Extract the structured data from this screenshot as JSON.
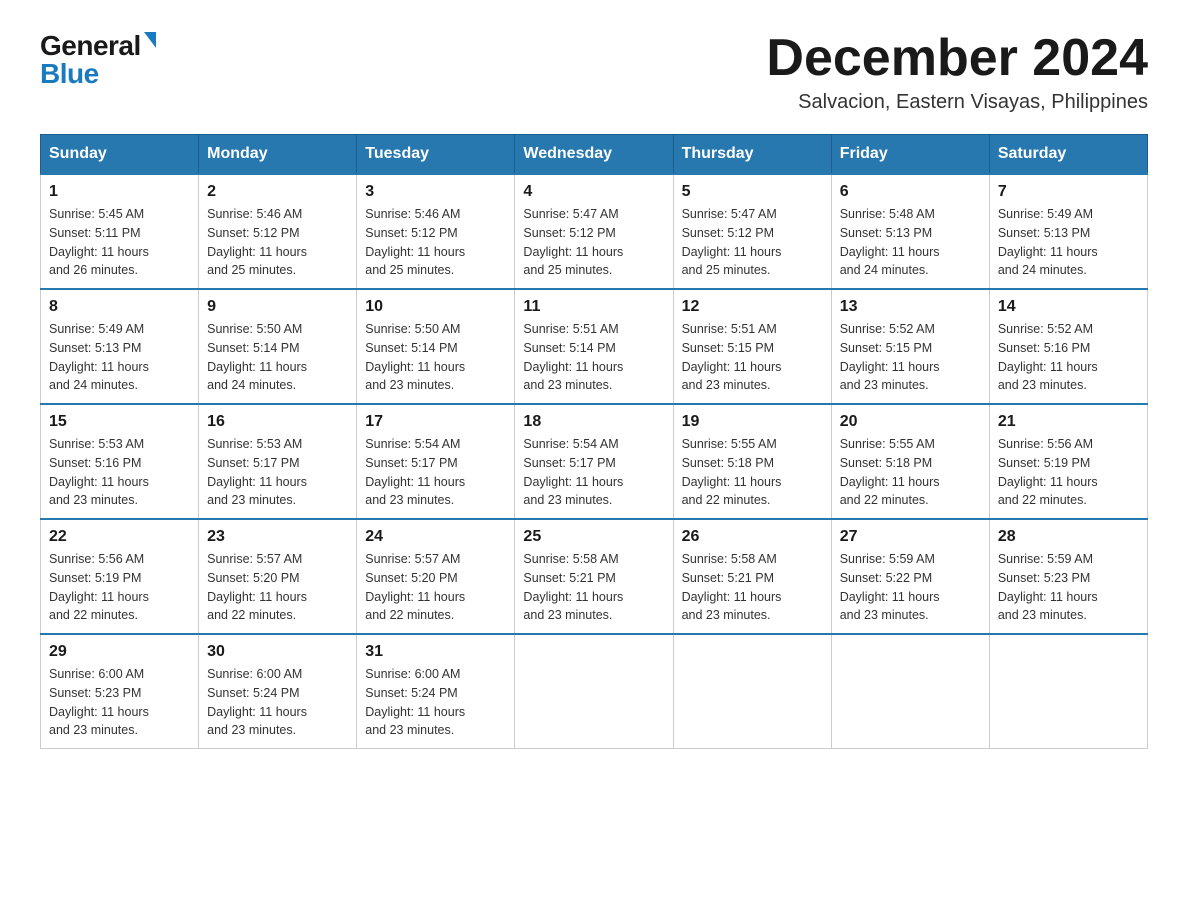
{
  "header": {
    "logo_general": "General",
    "logo_blue": "Blue",
    "month_title": "December 2024",
    "subtitle": "Salvacion, Eastern Visayas, Philippines"
  },
  "days_of_week": [
    "Sunday",
    "Monday",
    "Tuesday",
    "Wednesday",
    "Thursday",
    "Friday",
    "Saturday"
  ],
  "weeks": [
    [
      {
        "day": "1",
        "sunrise": "5:45 AM",
        "sunset": "5:11 PM",
        "daylight": "11 hours and 26 minutes."
      },
      {
        "day": "2",
        "sunrise": "5:46 AM",
        "sunset": "5:12 PM",
        "daylight": "11 hours and 25 minutes."
      },
      {
        "day": "3",
        "sunrise": "5:46 AM",
        "sunset": "5:12 PM",
        "daylight": "11 hours and 25 minutes."
      },
      {
        "day": "4",
        "sunrise": "5:47 AM",
        "sunset": "5:12 PM",
        "daylight": "11 hours and 25 minutes."
      },
      {
        "day": "5",
        "sunrise": "5:47 AM",
        "sunset": "5:12 PM",
        "daylight": "11 hours and 25 minutes."
      },
      {
        "day": "6",
        "sunrise": "5:48 AM",
        "sunset": "5:13 PM",
        "daylight": "11 hours and 24 minutes."
      },
      {
        "day": "7",
        "sunrise": "5:49 AM",
        "sunset": "5:13 PM",
        "daylight": "11 hours and 24 minutes."
      }
    ],
    [
      {
        "day": "8",
        "sunrise": "5:49 AM",
        "sunset": "5:13 PM",
        "daylight": "11 hours and 24 minutes."
      },
      {
        "day": "9",
        "sunrise": "5:50 AM",
        "sunset": "5:14 PM",
        "daylight": "11 hours and 24 minutes."
      },
      {
        "day": "10",
        "sunrise": "5:50 AM",
        "sunset": "5:14 PM",
        "daylight": "11 hours and 23 minutes."
      },
      {
        "day": "11",
        "sunrise": "5:51 AM",
        "sunset": "5:14 PM",
        "daylight": "11 hours and 23 minutes."
      },
      {
        "day": "12",
        "sunrise": "5:51 AM",
        "sunset": "5:15 PM",
        "daylight": "11 hours and 23 minutes."
      },
      {
        "day": "13",
        "sunrise": "5:52 AM",
        "sunset": "5:15 PM",
        "daylight": "11 hours and 23 minutes."
      },
      {
        "day": "14",
        "sunrise": "5:52 AM",
        "sunset": "5:16 PM",
        "daylight": "11 hours and 23 minutes."
      }
    ],
    [
      {
        "day": "15",
        "sunrise": "5:53 AM",
        "sunset": "5:16 PM",
        "daylight": "11 hours and 23 minutes."
      },
      {
        "day": "16",
        "sunrise": "5:53 AM",
        "sunset": "5:17 PM",
        "daylight": "11 hours and 23 minutes."
      },
      {
        "day": "17",
        "sunrise": "5:54 AM",
        "sunset": "5:17 PM",
        "daylight": "11 hours and 23 minutes."
      },
      {
        "day": "18",
        "sunrise": "5:54 AM",
        "sunset": "5:17 PM",
        "daylight": "11 hours and 23 minutes."
      },
      {
        "day": "19",
        "sunrise": "5:55 AM",
        "sunset": "5:18 PM",
        "daylight": "11 hours and 22 minutes."
      },
      {
        "day": "20",
        "sunrise": "5:55 AM",
        "sunset": "5:18 PM",
        "daylight": "11 hours and 22 minutes."
      },
      {
        "day": "21",
        "sunrise": "5:56 AM",
        "sunset": "5:19 PM",
        "daylight": "11 hours and 22 minutes."
      }
    ],
    [
      {
        "day": "22",
        "sunrise": "5:56 AM",
        "sunset": "5:19 PM",
        "daylight": "11 hours and 22 minutes."
      },
      {
        "day": "23",
        "sunrise": "5:57 AM",
        "sunset": "5:20 PM",
        "daylight": "11 hours and 22 minutes."
      },
      {
        "day": "24",
        "sunrise": "5:57 AM",
        "sunset": "5:20 PM",
        "daylight": "11 hours and 22 minutes."
      },
      {
        "day": "25",
        "sunrise": "5:58 AM",
        "sunset": "5:21 PM",
        "daylight": "11 hours and 23 minutes."
      },
      {
        "day": "26",
        "sunrise": "5:58 AM",
        "sunset": "5:21 PM",
        "daylight": "11 hours and 23 minutes."
      },
      {
        "day": "27",
        "sunrise": "5:59 AM",
        "sunset": "5:22 PM",
        "daylight": "11 hours and 23 minutes."
      },
      {
        "day": "28",
        "sunrise": "5:59 AM",
        "sunset": "5:23 PM",
        "daylight": "11 hours and 23 minutes."
      }
    ],
    [
      {
        "day": "29",
        "sunrise": "6:00 AM",
        "sunset": "5:23 PM",
        "daylight": "11 hours and 23 minutes."
      },
      {
        "day": "30",
        "sunrise": "6:00 AM",
        "sunset": "5:24 PM",
        "daylight": "11 hours and 23 minutes."
      },
      {
        "day": "31",
        "sunrise": "6:00 AM",
        "sunset": "5:24 PM",
        "daylight": "11 hours and 23 minutes."
      },
      null,
      null,
      null,
      null
    ]
  ],
  "labels": {
    "sunrise": "Sunrise:",
    "sunset": "Sunset:",
    "daylight": "Daylight:"
  }
}
